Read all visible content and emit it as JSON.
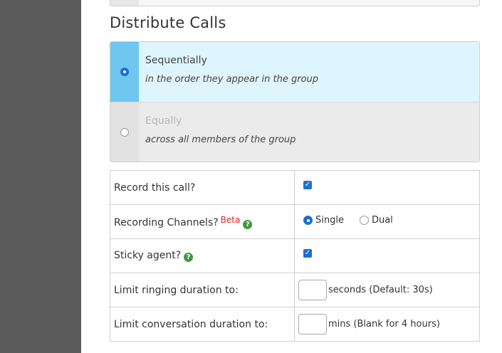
{
  "section": {
    "title": "Distribute Calls"
  },
  "distribution": {
    "options": [
      {
        "title": "Sequentially",
        "subtitle": "in the order they appear in the group",
        "selected": true
      },
      {
        "title": "Equally",
        "subtitle": "across all members of the group",
        "selected": false
      }
    ]
  },
  "settings": {
    "record": {
      "label": "Record this call?",
      "checked": true,
      "check_glyph": "✓"
    },
    "channels": {
      "label": "Recording Channels?",
      "badge": "Beta",
      "help_glyph": "?",
      "options": [
        {
          "label": "Single",
          "selected": true
        },
        {
          "label": "Dual",
          "selected": false
        }
      ]
    },
    "sticky": {
      "label": "Sticky agent?",
      "help_glyph": "?",
      "checked": true,
      "check_glyph": "✓"
    },
    "ringing": {
      "label": "Limit ringing duration to:",
      "value": "",
      "suffix": "seconds (Default: 30s)"
    },
    "conversation": {
      "label": "Limit conversation duration to:",
      "value": "",
      "suffix": "mins (Blank for 4 hours)"
    }
  },
  "colors": {
    "sidebar": "#5b5b5b",
    "selected_row": "#def5fd",
    "selected_rail": "#6fc6f0",
    "accent": "#1d6fd6",
    "beta": "#dd2222",
    "help": "#3d9a3d"
  }
}
